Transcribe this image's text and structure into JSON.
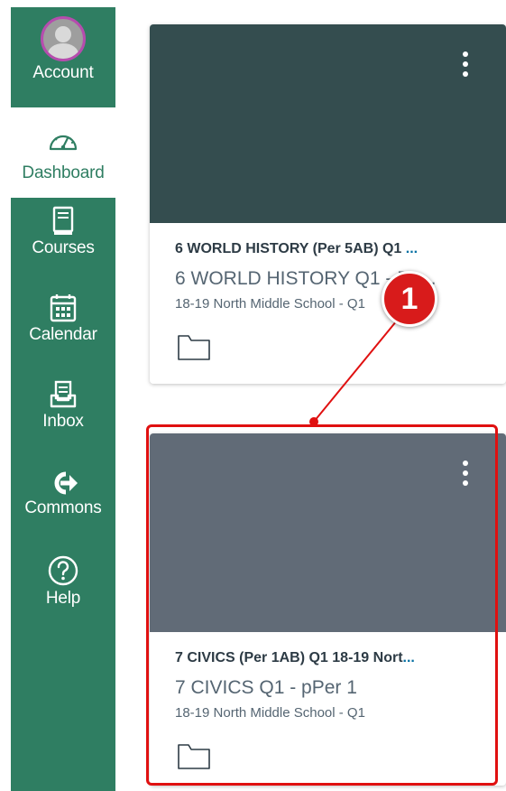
{
  "nav": {
    "account": "Account",
    "dashboard": "Dashboard",
    "courses": "Courses",
    "calendar": "Calendar",
    "inbox": "Inbox",
    "commons": "Commons",
    "help": "Help"
  },
  "cards": [
    {
      "title": "6 WORLD HISTORY (Per 5AB) Q1 ",
      "title_more": "...",
      "subtitle": "6 WORLD HISTORY Q1 - Pe...",
      "term": "18-19 North Middle School - Q1",
      "color": "#344d4f"
    },
    {
      "title": "7 CIVICS (Per 1AB) Q1 18-19 Nort",
      "title_more": "...",
      "subtitle": "7 CIVICS Q1 - pPer 1",
      "term": "18-19 North Middle School - Q1",
      "color": "#616b77"
    }
  ],
  "callout": {
    "number": "1",
    "color": "#d81b1b"
  },
  "colors": {
    "sidebar": "#2f7e62",
    "highlight": "#e01010"
  }
}
